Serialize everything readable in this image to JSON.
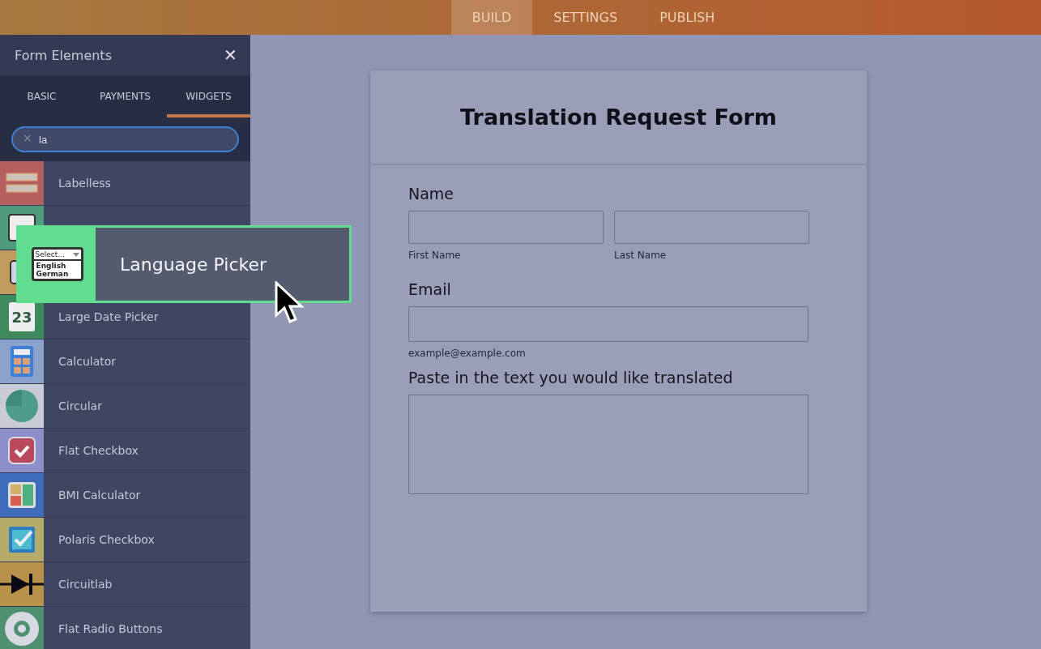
{
  "top_tabs": [
    {
      "label": "BUILD",
      "selected": true
    },
    {
      "label": "SETTINGS",
      "selected": false
    },
    {
      "label": "PUBLISH",
      "selected": false
    }
  ],
  "panel": {
    "title": "Form Elements",
    "close": "✕",
    "tabs": [
      {
        "label": "BASIC",
        "selected": false
      },
      {
        "label": "PAYMENTS",
        "selected": false
      },
      {
        "label": "WIDGETS",
        "selected": true
      }
    ],
    "search": {
      "clear": "×",
      "value": "la"
    },
    "items": [
      {
        "kind": "labelless",
        "color": "#b5605e",
        "label": "Labelless"
      },
      {
        "kind": "picker",
        "color": "#4e9c7c"
      },
      {
        "kind": "phone",
        "color": "#c19a5e"
      },
      {
        "kind": "date",
        "color": "#3e8a5e",
        "label": "Large Date Picker"
      },
      {
        "kind": "calculator",
        "color": "#8aa2cc",
        "label": "Calculator"
      },
      {
        "kind": "circular",
        "color": "#c9cbd6",
        "label": "Circular"
      },
      {
        "kind": "checkbox",
        "color": "#8c8fc9",
        "label": "Flat Checkbox"
      },
      {
        "kind": "bmi",
        "color": "#3f6dbb",
        "label": "BMI Calculator"
      },
      {
        "kind": "polaris",
        "color": "#b6ab6a",
        "label": "Polaris Checkbox"
      },
      {
        "kind": "diode",
        "color": "#b8914a",
        "label": "Circuitlab"
      },
      {
        "kind": "radio",
        "color": "#4e9070",
        "label": "Flat Radio Buttons"
      }
    ]
  },
  "drag": {
    "label": "Language Picker",
    "icon_select": "Select...",
    "icon_options": [
      "English",
      "German"
    ]
  },
  "date_icon_day": "23",
  "form": {
    "title": "Translation Request Form",
    "name": {
      "label": "Name",
      "sublabels": [
        "First Name",
        "Last Name"
      ]
    },
    "email": {
      "label": "Email",
      "sublabel": "example@example.com"
    },
    "text": {
      "label": "Paste in the text you would like translated"
    }
  }
}
